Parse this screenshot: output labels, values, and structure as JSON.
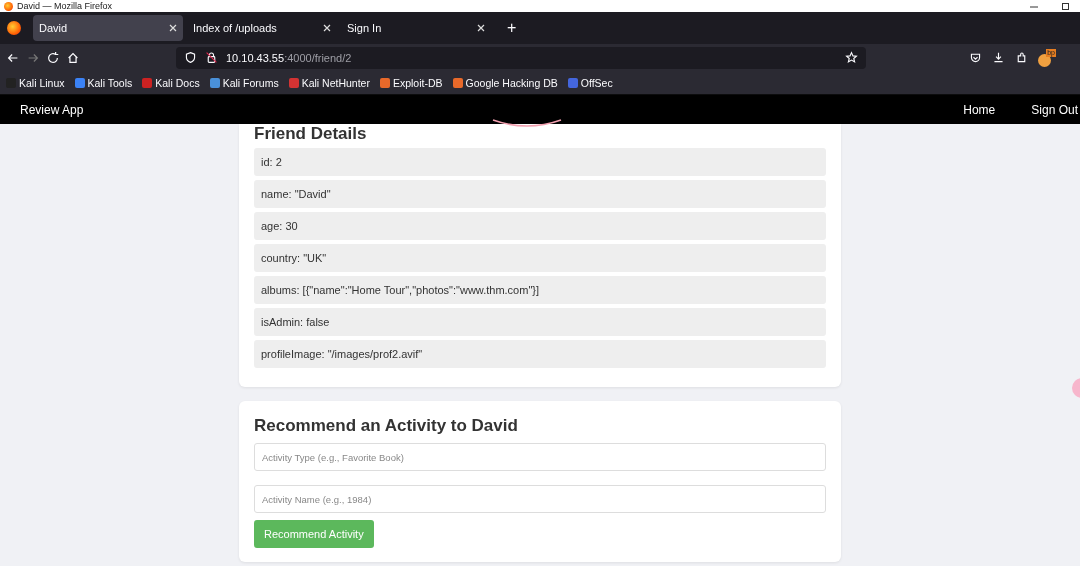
{
  "window": {
    "title": "David — Mozilla Firefox"
  },
  "tabs": [
    {
      "label": "David",
      "selected": true
    },
    {
      "label": "Index of /uploads",
      "selected": false
    },
    {
      "label": "Sign In",
      "selected": false
    }
  ],
  "new_tab": "+",
  "address_bar": {
    "host": "10.10.43.55",
    "path": ":4000/friend/2"
  },
  "bookmarks": [
    {
      "label": "Kali Linux",
      "color": "#222222"
    },
    {
      "label": "Kali Tools",
      "color": "#3b82f6"
    },
    {
      "label": "Kali Docs",
      "color": "#cc2222"
    },
    {
      "label": "Kali Forums",
      "color": "#4a90d9"
    },
    {
      "label": "Kali NetHunter",
      "color": "#d33333"
    },
    {
      "label": "Exploit-DB",
      "color": "#e8692a"
    },
    {
      "label": "Google Hacking DB",
      "color": "#e8692a"
    },
    {
      "label": "OffSec",
      "color": "#4466dd"
    }
  ],
  "extension_badge": "bp",
  "navbar": {
    "brand": "Review App",
    "links": [
      "Home",
      "Sign Out"
    ]
  },
  "friend_details": {
    "title": "Friend Details",
    "fields": [
      "id: 2",
      "name: \"David\"",
      "age: 30",
      "country: \"UK\"",
      "albums: [{\"name\":\"Home Tour\",\"photos\":\"www.thm.com\"}]",
      "isAdmin: false",
      "profileImage: \"/images/prof2.avif\""
    ]
  },
  "recommend": {
    "title": "Recommend an Activity to David",
    "inputs": [
      {
        "placeholder": "Activity Type (e.g., Favorite Book)"
      },
      {
        "placeholder": "Activity Name (e.g., 1984)"
      }
    ],
    "button": "Recommend Activity"
  }
}
